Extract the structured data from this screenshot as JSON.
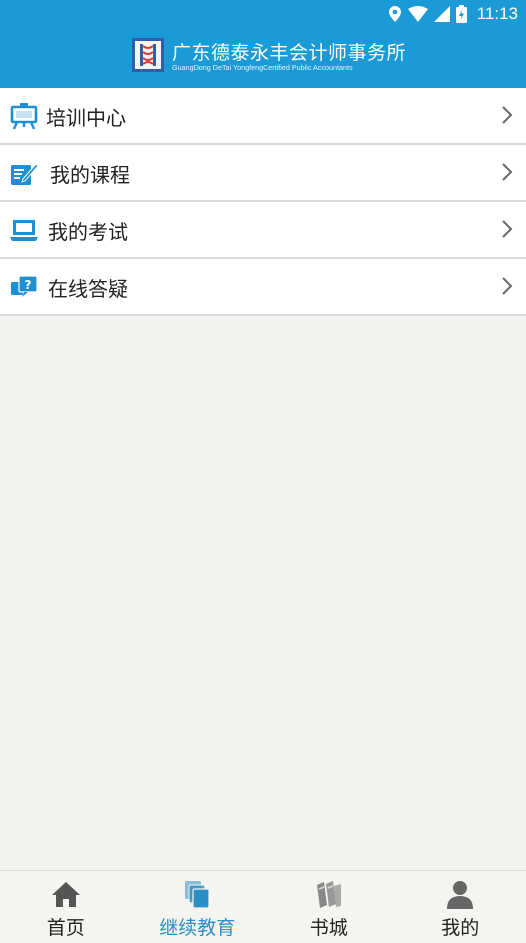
{
  "status": {
    "time": "11:13"
  },
  "header": {
    "title": "广东德泰永丰会计师事务所",
    "subtitle": "GuangDong DeTai YongfengCertified Public Accountants"
  },
  "menu": [
    {
      "label": "培训中心",
      "icon": "training-board-icon"
    },
    {
      "label": "我的课程",
      "icon": "edit-course-icon"
    },
    {
      "label": "我的考试",
      "icon": "laptop-exam-icon"
    },
    {
      "label": "在线答疑",
      "icon": "question-chat-icon"
    }
  ],
  "tabs": [
    {
      "label": "首页",
      "icon": "home-icon",
      "active": false
    },
    {
      "label": "继续教育",
      "icon": "education-stack-icon",
      "active": true
    },
    {
      "label": "书城",
      "icon": "books-icon",
      "active": false
    },
    {
      "label": "我的",
      "icon": "user-icon",
      "active": false
    }
  ],
  "colors": {
    "brand": "#1a9ad6",
    "active_tab": "#2a8fc4",
    "icon_blue": "#1e8fd0"
  }
}
